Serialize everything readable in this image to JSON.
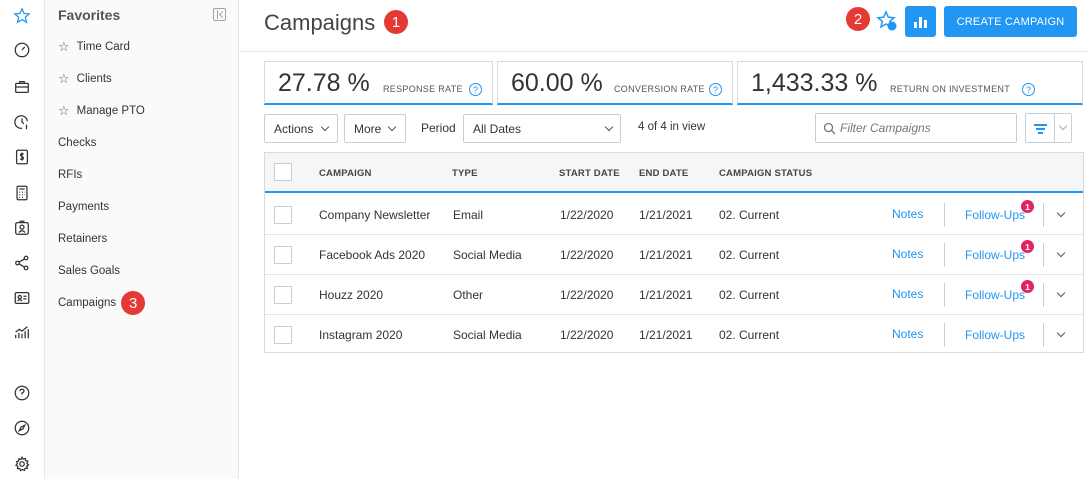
{
  "rail": {
    "icons": [
      "star-icon",
      "gauge-icon",
      "briefcase-icon",
      "clock-dollar-icon",
      "dollar-document-icon",
      "calculator-icon",
      "user-badge-icon",
      "share-network-icon",
      "contact-card-icon",
      "growth-chart-icon",
      "help-circle-icon",
      "compass-icon",
      "settings-icon"
    ]
  },
  "sidebar": {
    "title": "Favorites",
    "favorites": [
      {
        "label": "Time Card",
        "icon": "star-icon"
      },
      {
        "label": "Clients",
        "icon": "star-icon"
      },
      {
        "label": "Manage PTO",
        "icon": "star-icon"
      }
    ],
    "items": [
      "Checks",
      "RFIs",
      "Payments",
      "Retainers",
      "Sales Goals",
      "Campaigns"
    ]
  },
  "annotations": {
    "title_badge": "1",
    "favorite_badge": "2",
    "sidebar_badge": "3"
  },
  "header": {
    "title": "Campaigns",
    "create_label": "CREATE CAMPAIGN",
    "accent_color": "#2196f3"
  },
  "metrics": [
    {
      "value": "27.78 %",
      "label": "RESPONSE RATE",
      "help": "?"
    },
    {
      "value": "60.00 %",
      "label": "CONVERSION RATE",
      "help": "?"
    },
    {
      "value": "1,433.33 %",
      "label": "RETURN ON INVESTMENT",
      "help": "?"
    }
  ],
  "toolbar": {
    "actions_label": "Actions",
    "more_label": "More",
    "period_label": "Period",
    "period_value": "All Dates",
    "in_view": "4 of 4 in view",
    "search_placeholder": "Filter Campaigns"
  },
  "table": {
    "columns": [
      "CAMPAIGN",
      "TYPE",
      "START DATE",
      "END DATE",
      "CAMPAIGN STATUS"
    ],
    "notes_label": "Notes",
    "followups_label": "Follow-Ups",
    "rows": [
      {
        "campaign": "Company Newsletter",
        "type": "Email",
        "start": "1/22/2020",
        "end": "1/21/2021",
        "status": "02. Current",
        "followups_count": "1"
      },
      {
        "campaign": "Facebook Ads 2020",
        "type": "Social Media",
        "start": "1/22/2020",
        "end": "1/21/2021",
        "status": "02. Current",
        "followups_count": "1"
      },
      {
        "campaign": "Houzz 2020",
        "type": "Other",
        "start": "1/22/2020",
        "end": "1/21/2021",
        "status": "02. Current",
        "followups_count": "1"
      },
      {
        "campaign": "Instagram 2020",
        "type": "Social Media",
        "start": "1/22/2020",
        "end": "1/21/2021",
        "status": "02. Current",
        "followups_count": ""
      }
    ]
  }
}
